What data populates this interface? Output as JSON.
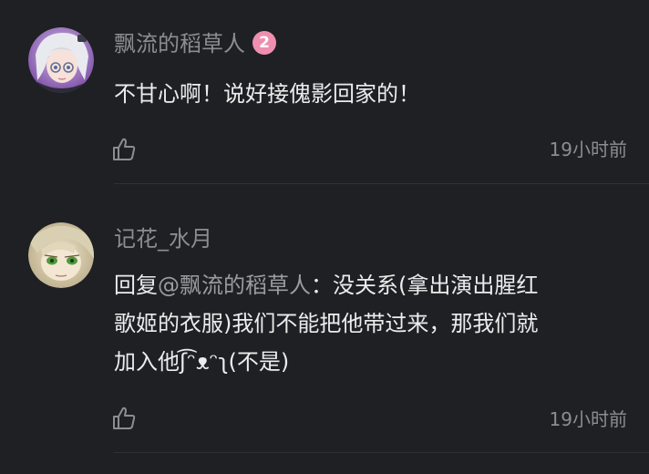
{
  "comments": [
    {
      "username": "飘流的稻草人",
      "level": "2",
      "text": "不甘心啊！说好接傀影回家的！",
      "avatar_icon": "anime-girl-avatar",
      "timestamp": "19小时前"
    },
    {
      "username": "记花_水月",
      "reply_prefix": "回复",
      "mention": "@飘流的稻草人",
      "line1_rest": "：没关系(拿出演出腥红",
      "line2": "歌姬的衣服)我们不能把他带过来，那我们就",
      "line3": "加入他ʃ͡ᵔᴥᵔʅ(不是)",
      "avatar_icon": "green-eyed-character-avatar",
      "timestamp": "19小时前"
    }
  ],
  "colors": {
    "background": "#1f2024",
    "username": "#8c8d91",
    "text": "#ececec",
    "badge": "#ef8fb0"
  }
}
